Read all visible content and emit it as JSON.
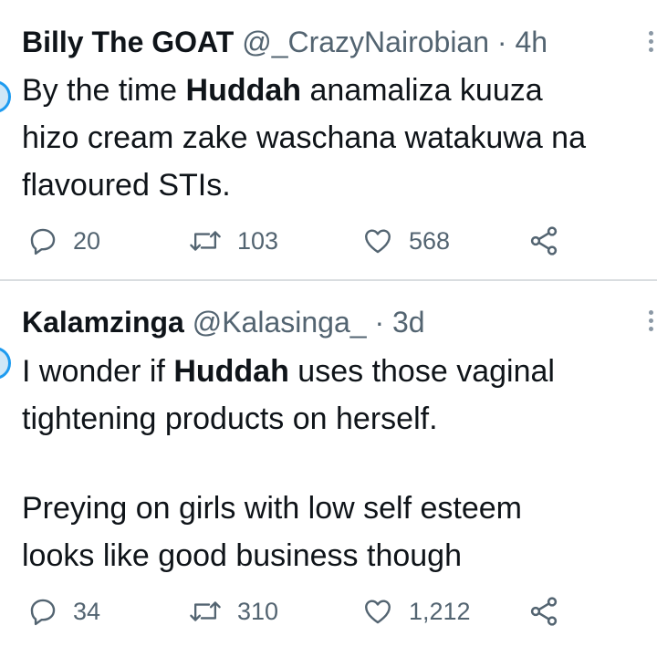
{
  "tweets": [
    {
      "display_name": "Billy The GOAT",
      "handle": "@_CrazyNairobian",
      "separator": "·",
      "time": "4h",
      "body_lines": [
        [
          {
            "text": "By the time ",
            "bold": false
          },
          {
            "text": "Huddah",
            "bold": true
          },
          {
            "text": " anamaliza kuuza",
            "bold": false
          }
        ],
        [
          {
            "text": "hizo cream zake waschana watakuwa na",
            "bold": false
          }
        ],
        [
          {
            "text": "flavoured STIs.",
            "bold": false
          }
        ]
      ],
      "replies": "20",
      "retweets": "103",
      "likes": "568"
    },
    {
      "display_name": "Kalamzinga",
      "handle": "@Kalasinga_",
      "separator": "·",
      "time": "3d",
      "body_lines": [
        [
          {
            "text": "I wonder if ",
            "bold": false
          },
          {
            "text": "Huddah",
            "bold": true
          },
          {
            "text": " uses those vaginal",
            "bold": false
          }
        ],
        [
          {
            "text": "tightening products on herself.",
            "bold": false
          }
        ],
        [],
        [
          {
            "text": "Preying on girls with low self esteem",
            "bold": false
          }
        ],
        [
          {
            "text": "looks like good business though",
            "bold": false
          }
        ]
      ],
      "replies": "34",
      "retweets": "310",
      "likes": "1,212"
    }
  ],
  "icons": {
    "reply": "reply-icon",
    "retweet": "retweet-icon",
    "like": "heart-icon",
    "share": "share-icon",
    "more": "more-icon"
  },
  "colors": {
    "text": "#0f1419",
    "secondary": "#536471",
    "divider": "#d9dde0"
  }
}
